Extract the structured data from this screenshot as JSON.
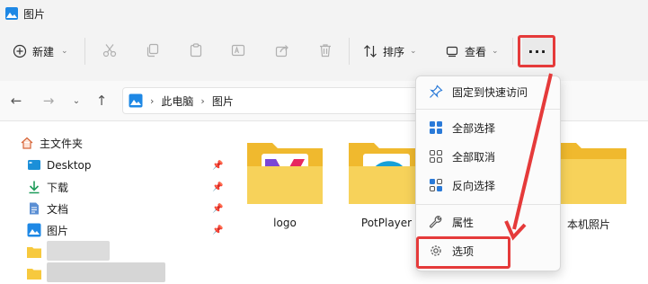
{
  "window": {
    "title": "图片"
  },
  "toolbar": {
    "new_label": "新建",
    "sort_label": "排序",
    "view_label": "查看",
    "more_label": "···"
  },
  "nav": {
    "breadcrumb": [
      "此电脑",
      "图片"
    ]
  },
  "sidebar": {
    "items": [
      {
        "label": "主文件夹",
        "icon": "home-icon"
      },
      {
        "label": "Desktop",
        "icon": "desktop-icon",
        "pinned": true
      },
      {
        "label": "下载",
        "icon": "download-icon",
        "pinned": true
      },
      {
        "label": "文档",
        "icon": "document-icon",
        "pinned": true
      },
      {
        "label": "图片",
        "icon": "pictures-icon",
        "pinned": true
      }
    ]
  },
  "files": [
    {
      "name": "logo"
    },
    {
      "name": "PotPlayer"
    },
    {
      "name": "本机照片"
    }
  ],
  "menu": {
    "items": [
      {
        "label": "固定到快速访问",
        "icon": "pin-icon"
      },
      {
        "label": "全部选择",
        "icon": "select-all-icon"
      },
      {
        "label": "全部取消",
        "icon": "select-none-icon"
      },
      {
        "label": "反向选择",
        "icon": "invert-selection-icon"
      },
      {
        "label": "属性",
        "icon": "properties-icon"
      },
      {
        "label": "选项",
        "icon": "options-icon"
      }
    ]
  },
  "colors": {
    "highlight": "#e53a3a",
    "accent": "#0067c0",
    "folder": "#f7c93e"
  }
}
